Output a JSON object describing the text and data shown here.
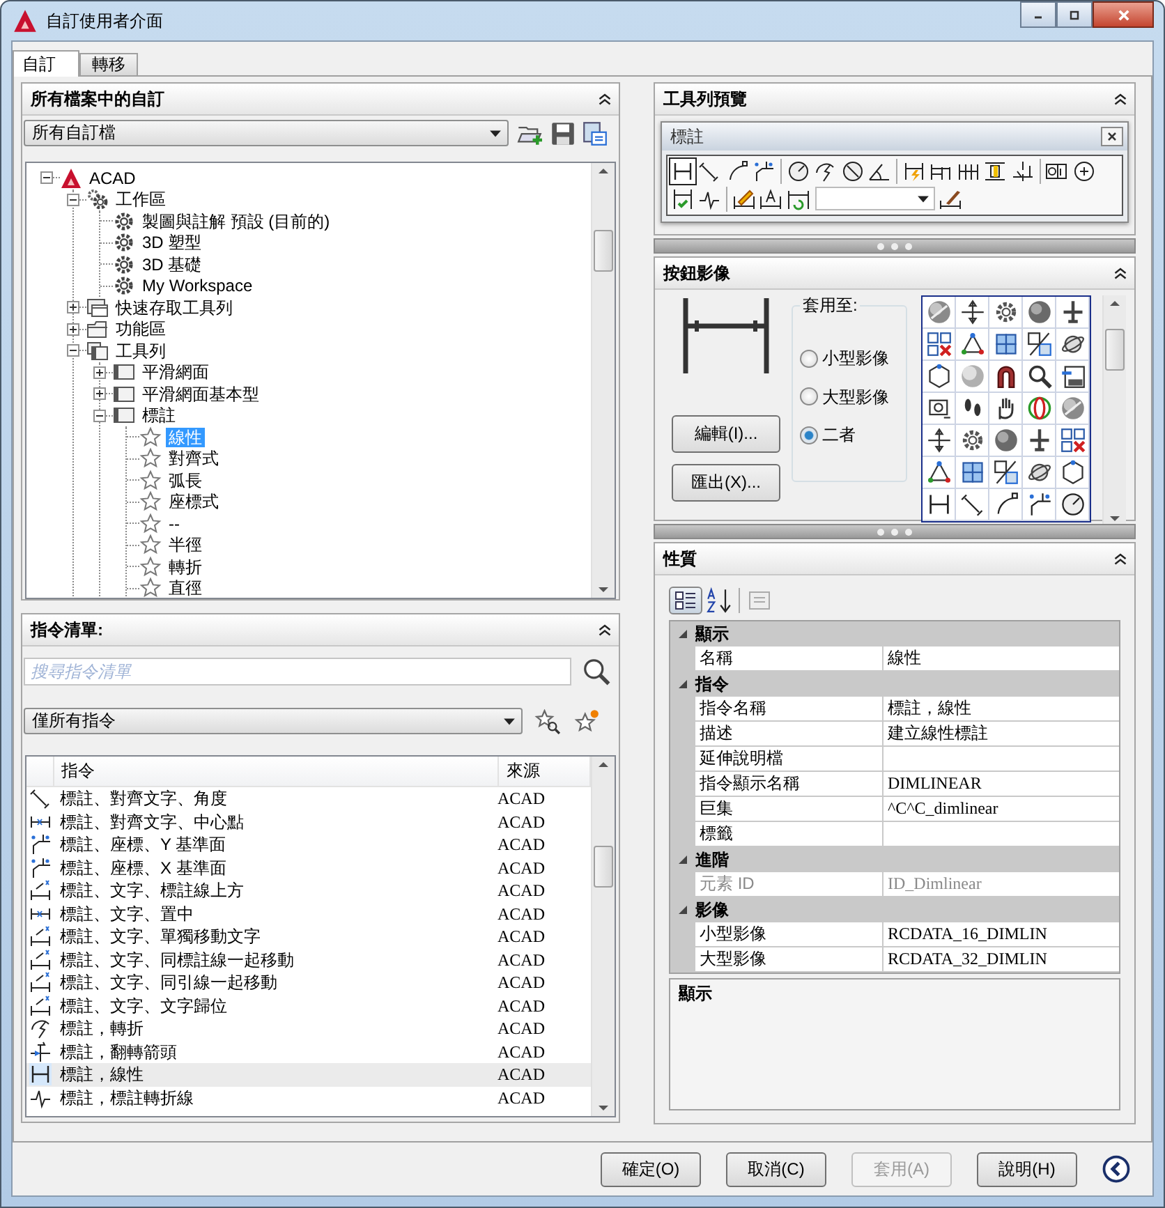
{
  "window": {
    "title": "自訂使用者介面"
  },
  "tabs": [
    {
      "label": "自訂",
      "selected": true
    },
    {
      "label": "轉移",
      "selected": false
    }
  ],
  "customizations_panel": {
    "title": "所有檔案中的自訂",
    "file_filter": "所有自訂檔",
    "tree": [
      {
        "label": "ACAD",
        "kind": "acad",
        "expanded": true,
        "selected": false,
        "children": [
          {
            "label": "工作區",
            "kind": "workspaces",
            "expanded": true,
            "selected": false,
            "children": [
              {
                "label": "製圖與註解 預設 (目前的)",
                "kind": "workspace",
                "selected": false
              },
              {
                "label": "3D 塑型",
                "kind": "workspace",
                "selected": false
              },
              {
                "label": "3D 基礎",
                "kind": "workspace",
                "selected": false
              },
              {
                "label": "My Workspace",
                "kind": "workspace",
                "selected": false
              }
            ]
          },
          {
            "label": "快速存取工具列",
            "kind": "quick-access",
            "expanded": false,
            "selected": false
          },
          {
            "label": "功能區",
            "kind": "ribbon",
            "expanded": false,
            "selected": false
          },
          {
            "label": "工具列",
            "kind": "toolbars",
            "expanded": true,
            "selected": false,
            "children": [
              {
                "label": "平滑網面",
                "kind": "toolbar",
                "expanded": false,
                "selected": false
              },
              {
                "label": "平滑網面基本型",
                "kind": "toolbar",
                "expanded": false,
                "selected": false
              },
              {
                "label": "標註",
                "kind": "toolbar",
                "expanded": true,
                "selected": false,
                "children": [
                  {
                    "label": "線性",
                    "kind": "command",
                    "selected": true
                  },
                  {
                    "label": "對齊式",
                    "kind": "command",
                    "selected": false
                  },
                  {
                    "label": "弧長",
                    "kind": "command",
                    "selected": false
                  },
                  {
                    "label": "座標式",
                    "kind": "command",
                    "selected": false
                  },
                  {
                    "label": "--",
                    "kind": "command",
                    "selected": false
                  },
                  {
                    "label": "半徑",
                    "kind": "command",
                    "selected": false
                  },
                  {
                    "label": "轉折",
                    "kind": "command",
                    "selected": false
                  },
                  {
                    "label": "直徑",
                    "kind": "command",
                    "selected": false
                  }
                ]
              }
            ]
          }
        ]
      }
    ]
  },
  "command_list_panel": {
    "title": "指令清單:",
    "search": {
      "placeholder": "搜尋指令清單"
    },
    "filter": "僅所有指令",
    "columns": [
      "指令",
      "來源"
    ],
    "rows": [
      {
        "command": "標註、對齊文字、角度",
        "source": "ACAD",
        "selected": false
      },
      {
        "command": "標註、對齊文字、中心點",
        "source": "ACAD",
        "selected": false
      },
      {
        "command": "標註、座標、Y 基準面",
        "source": "ACAD",
        "selected": false
      },
      {
        "command": "標註、座標、X 基準面",
        "source": "ACAD",
        "selected": false
      },
      {
        "command": "標註、文字、標註線上方",
        "source": "ACAD",
        "selected": false
      },
      {
        "command": "標註、文字、置中",
        "source": "ACAD",
        "selected": false
      },
      {
        "command": "標註、文字、單獨移動文字",
        "source": "ACAD",
        "selected": false
      },
      {
        "command": "標註、文字、同標註線一起移動",
        "source": "ACAD",
        "selected": false
      },
      {
        "command": "標註、文字、同引線一起移動",
        "source": "ACAD",
        "selected": false
      },
      {
        "command": "標註、文字、文字歸位",
        "source": "ACAD",
        "selected": false
      },
      {
        "command": "標註，轉折",
        "source": "ACAD",
        "selected": false
      },
      {
        "command": "標註，翻轉箭頭",
        "source": "ACAD",
        "selected": false
      },
      {
        "command": "標註，線性",
        "source": "ACAD",
        "selected": true
      },
      {
        "command": "標註，標註轉折線",
        "source": "ACAD",
        "selected": false
      }
    ]
  },
  "toolbar_preview_panel": {
    "title": "工具列預覽",
    "toolbar_title": "標註"
  },
  "button_image_panel": {
    "title": "按鈕影像",
    "apply_to_label": "套用至:",
    "options": [
      {
        "label": "小型影像",
        "selected": false
      },
      {
        "label": "大型影像",
        "selected": false
      },
      {
        "label": "二者",
        "selected": true
      }
    ],
    "buttons": [
      "編輯(I)...",
      "匯出(X)..."
    ]
  },
  "properties_panel": {
    "title": "性質",
    "groups": [
      {
        "title": "顯示",
        "expanded": true,
        "rows": [
          {
            "name": "名稱",
            "value": "線性",
            "disabled": false
          }
        ]
      },
      {
        "title": "指令",
        "expanded": true,
        "rows": [
          {
            "name": "指令名稱",
            "value": "標註，線性",
            "disabled": false
          },
          {
            "name": "描述",
            "value": "建立線性標註",
            "disabled": false
          },
          {
            "name": "延伸說明檔",
            "disabled": false
          },
          {
            "name": "指令顯示名稱",
            "value": "DIMLINEAR",
            "disabled": false
          },
          {
            "name": "巨集",
            "value": "^C^C_dimlinear",
            "disabled": false
          },
          {
            "name": "標籤",
            "disabled": false
          }
        ]
      },
      {
        "title": "進階",
        "expanded": true,
        "rows": [
          {
            "name": "元素 ID",
            "value": "ID_Dimlinear",
            "disabled": true
          }
        ]
      },
      {
        "title": "影像",
        "expanded": true,
        "rows": [
          {
            "name": "小型影像",
            "value": "RCDATA_16_DIMLIN",
            "disabled": false
          },
          {
            "name": "大型影像",
            "value": "RCDATA_32_DIMLIN",
            "disabled": false
          }
        ]
      }
    ],
    "description_title": "顯示"
  },
  "footer_buttons": [
    {
      "label": "確定(O)",
      "disabled": false
    },
    {
      "label": "取消(C)",
      "disabled": false
    },
    {
      "label": "套用(A)",
      "disabled": true
    },
    {
      "label": "說明(H)",
      "disabled": false
    }
  ]
}
